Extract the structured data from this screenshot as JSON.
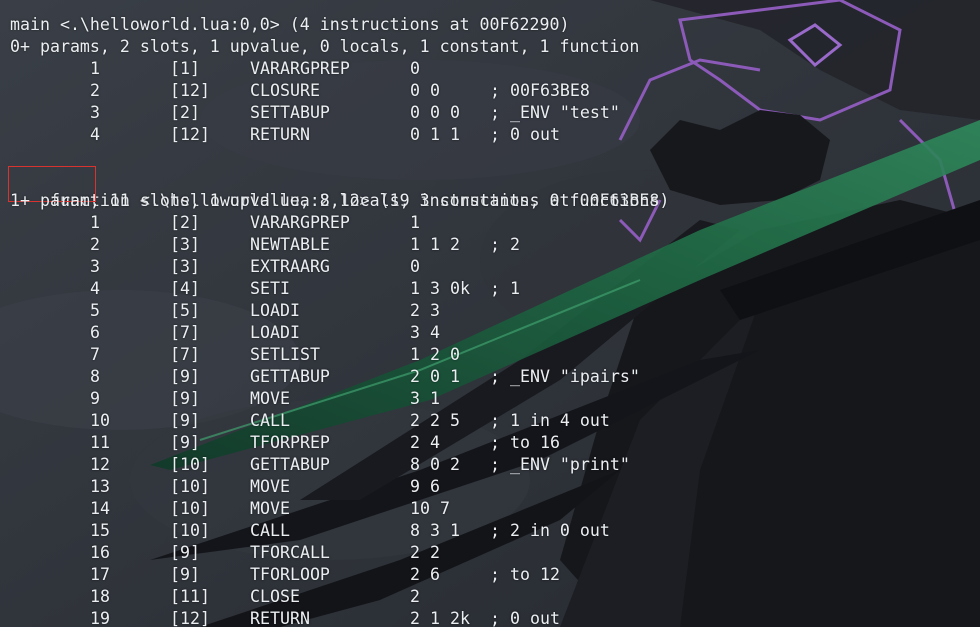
{
  "main_block": {
    "header": "main <.\\helloworld.lua:0,0> (4 instructions at 00F62290)",
    "summary": "0+ params, 2 slots, 1 upvalue, 0 locals, 1 constant, 1 function",
    "instructions": [
      {
        "idx": "1",
        "line": "[1]",
        "op": "VARARGPREP",
        "args": "0",
        "comment": ""
      },
      {
        "idx": "2",
        "line": "[12]",
        "op": "CLOSURE",
        "args": "0 0",
        "comment": "; 00F63BE8"
      },
      {
        "idx": "3",
        "line": "[2]",
        "op": "SETTABUP",
        "args": "0 0 0",
        "comment": "; _ENV \"test\""
      },
      {
        "idx": "4",
        "line": "[12]",
        "op": "RETURN",
        "args": "0 1 1",
        "comment": "; 0 out"
      }
    ]
  },
  "function_block": {
    "keyword": "function",
    "header_rest": " <.\\helloworld.lua:2,12> (19 instructions at 00F63BE8)",
    "summary": "1+ param, 11 slots, 1 upvalue, 8 locals, 3 constants, 0 functions",
    "instructions": [
      {
        "idx": "1",
        "line": "[2]",
        "op": "VARARGPREP",
        "args": "1",
        "comment": ""
      },
      {
        "idx": "2",
        "line": "[3]",
        "op": "NEWTABLE",
        "args": "1 1 2",
        "comment": "; 2"
      },
      {
        "idx": "3",
        "line": "[3]",
        "op": "EXTRAARG",
        "args": "0",
        "comment": ""
      },
      {
        "idx": "4",
        "line": "[4]",
        "op": "SETI",
        "args": "1 3 0k",
        "comment": "; 1"
      },
      {
        "idx": "5",
        "line": "[5]",
        "op": "LOADI",
        "args": "2 3",
        "comment": ""
      },
      {
        "idx": "6",
        "line": "[7]",
        "op": "LOADI",
        "args": "3 4",
        "comment": ""
      },
      {
        "idx": "7",
        "line": "[7]",
        "op": "SETLIST",
        "args": "1 2 0",
        "comment": ""
      },
      {
        "idx": "8",
        "line": "[9]",
        "op": "GETTABUP",
        "args": "2 0 1",
        "comment": "; _ENV \"ipairs\""
      },
      {
        "idx": "9",
        "line": "[9]",
        "op": "MOVE",
        "args": "3 1",
        "comment": ""
      },
      {
        "idx": "10",
        "line": "[9]",
        "op": "CALL",
        "args": "2 2 5",
        "comment": "; 1 in 4 out"
      },
      {
        "idx": "11",
        "line": "[9]",
        "op": "TFORPREP",
        "args": "2 4",
        "comment": "; to 16"
      },
      {
        "idx": "12",
        "line": "[10]",
        "op": "GETTABUP",
        "args": "8 0 2",
        "comment": "; _ENV \"print\""
      },
      {
        "idx": "13",
        "line": "[10]",
        "op": "MOVE",
        "args": "9 6",
        "comment": ""
      },
      {
        "idx": "14",
        "line": "[10]",
        "op": "MOVE",
        "args": "10 7",
        "comment": ""
      },
      {
        "idx": "15",
        "line": "[10]",
        "op": "CALL",
        "args": "8 3 1",
        "comment": "; 2 in 0 out"
      },
      {
        "idx": "16",
        "line": "[9]",
        "op": "TFORCALL",
        "args": "2 2",
        "comment": ""
      },
      {
        "idx": "17",
        "line": "[9]",
        "op": "TFORLOOP",
        "args": "2 6",
        "comment": "; to 12"
      },
      {
        "idx": "18",
        "line": "[11]",
        "op": "CLOSE",
        "args": "2",
        "comment": ""
      },
      {
        "idx": "19",
        "line": "[12]",
        "op": "RETURN",
        "args": "2 1 2k",
        "comment": "; 0 out"
      }
    ]
  },
  "colors": {
    "text": "#eceff2",
    "highlight_box": "#d8332e",
    "background": "#2b2f36"
  }
}
